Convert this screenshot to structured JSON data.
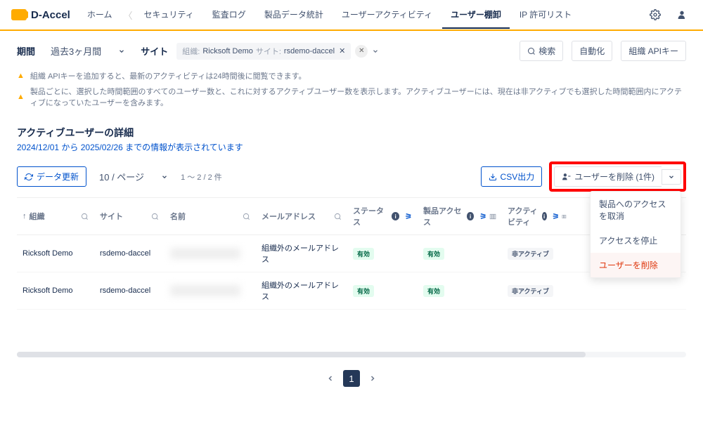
{
  "brand": "D-Accel",
  "nav": {
    "items": [
      "ホーム",
      "セキュリティ",
      "監査ログ",
      "製品データ統計",
      "ユーザーアクティビティ",
      "ユーザー棚卸",
      "IP 許可リスト"
    ],
    "activeIndex": 5
  },
  "filter": {
    "periodLabel": "期間",
    "periodValue": "過去3ヶ月間",
    "siteLabel": "サイト",
    "chip": {
      "orgLabel": "組織:",
      "orgValue": "Ricksoft Demo",
      "siteLabel": "サイト:",
      "siteValue": "rsdemo-daccel"
    },
    "searchLabel": "検索",
    "automateLabel": "自動化",
    "apiKeyLabel": "組織 APIキー"
  },
  "alerts": [
    "組織 APIキーを追加すると、最新のアクティビティは24時間後に閲覧できます。",
    "製品ごとに、選択した時間範囲のすべてのユーザー数と、これに対するアクティブユーザー数を表示します。アクティブユーザーには、現在は非アクティブでも選択した時間範囲内にアクティブになっていたユーザーを含みます。"
  ],
  "panel": {
    "title": "アクティブユーザーの詳細",
    "subtitle": "2024/12/01 から 2025/02/26 までの情報が表示されています"
  },
  "toolbar": {
    "refresh": "データ更新",
    "pageSize": "10 / ページ",
    "rangeText": "1 ～ 2 / 2 件",
    "csv": "CSV出力",
    "actionLabel": "ユーザーを削除 (1件)",
    "menu": [
      "製品へのアクセスを取消",
      "アクセスを停止",
      "ユーザーを削除"
    ]
  },
  "columns": {
    "org": "組織",
    "site": "サイト",
    "name": "名前",
    "email": "メールアドレス",
    "status": "ステータス",
    "access": "製品アクセス",
    "activity": "アクティビティ"
  },
  "rows": [
    {
      "org": "Ricksoft Demo",
      "site": "rsdemo-daccel",
      "email": "組織外のメールアドレス",
      "status": "有効",
      "access": "有効",
      "activity": "非アクティブ"
    },
    {
      "org": "Ricksoft Demo",
      "site": "rsdemo-daccel",
      "email": "組織外のメールアドレス",
      "status": "有効",
      "access": "有効",
      "activity": "非アクティブ"
    }
  ],
  "pager": {
    "current": "1"
  }
}
